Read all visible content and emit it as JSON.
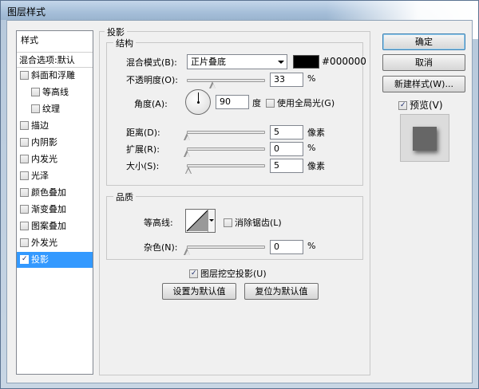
{
  "window": {
    "title": "图层样式"
  },
  "style_list": {
    "header": "样式",
    "blend_options": "混合选项:默认",
    "items": [
      {
        "label": "斜面和浮雕",
        "checked": false,
        "indent": false
      },
      {
        "label": "等高线",
        "checked": false,
        "indent": true
      },
      {
        "label": "纹理",
        "checked": false,
        "indent": true
      },
      {
        "label": "描边",
        "checked": false,
        "indent": false
      },
      {
        "label": "内阴影",
        "checked": false,
        "indent": false
      },
      {
        "label": "内发光",
        "checked": false,
        "indent": false
      },
      {
        "label": "光泽",
        "checked": false,
        "indent": false
      },
      {
        "label": "颜色叠加",
        "checked": false,
        "indent": false
      },
      {
        "label": "渐变叠加",
        "checked": false,
        "indent": false
      },
      {
        "label": "图案叠加",
        "checked": false,
        "indent": false
      },
      {
        "label": "外发光",
        "checked": false,
        "indent": false
      },
      {
        "label": "投影",
        "checked": true,
        "indent": false,
        "selected": true
      }
    ]
  },
  "drop_shadow": {
    "title": "投影",
    "structure": {
      "title": "结构",
      "blend_mode_label": "混合模式(B):",
      "blend_mode_value": "正片叠底",
      "color_hex": "#000000",
      "color_swatch": "#000000",
      "opacity_label": "不透明度(O):",
      "opacity_value": "33",
      "opacity_percent": 33,
      "opacity_unit": "%",
      "angle_label": "角度(A):",
      "angle_value": "90",
      "angle_unit": "度",
      "global_light_label": "使用全局光(G)",
      "global_light_checked": false,
      "distance_label": "距离(D):",
      "distance_value": "5",
      "distance_unit": "像素",
      "spread_label": "扩展(R):",
      "spread_value": "0",
      "spread_unit": "%",
      "size_label": "大小(S):",
      "size_value": "5",
      "size_unit": "像素"
    },
    "quality": {
      "title": "品质",
      "contour_label": "等高线:",
      "anti_alias_label": "消除锯齿(L)",
      "anti_alias_checked": false,
      "noise_label": "杂色(N):",
      "noise_value": "0",
      "noise_unit": "%"
    },
    "knockout_label": "图层挖空投影(U)",
    "knockout_checked": true,
    "make_default_label": "设置为默认值",
    "reset_default_label": "复位为默认值"
  },
  "buttons": {
    "ok": "确定",
    "cancel": "取消",
    "new_style": "新建样式(W)...",
    "preview_label": "预览(V)",
    "preview_checked": true
  }
}
